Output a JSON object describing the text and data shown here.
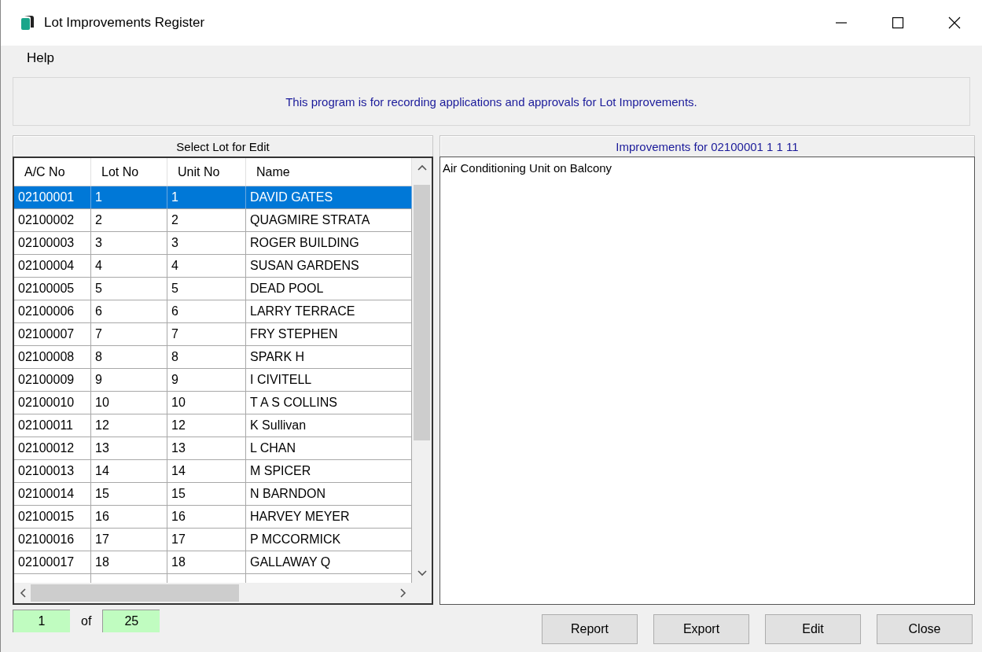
{
  "window": {
    "title": "Lot Improvements Register"
  },
  "menu": [
    "Help"
  ],
  "info": "This program is for recording applications and approvals for Lot Improvements.",
  "lot_panel": {
    "title": "Select Lot for Edit",
    "columns": [
      "A/C No",
      "Lot No",
      "Unit No",
      "Name"
    ],
    "rows": [
      {
        "cells": [
          "02100001",
          "1",
          "1",
          "DAVID GATES"
        ],
        "selected": true
      },
      {
        "cells": [
          "02100002",
          "2",
          "2",
          "QUAGMIRE STRATA"
        ],
        "selected": false
      },
      {
        "cells": [
          "02100003",
          "3",
          "3",
          "ROGER BUILDING"
        ],
        "selected": false
      },
      {
        "cells": [
          "02100004",
          "4",
          "4",
          "SUSAN GARDENS"
        ],
        "selected": false
      },
      {
        "cells": [
          "02100005",
          "5",
          "5",
          "DEAD POOL"
        ],
        "selected": false
      },
      {
        "cells": [
          "02100006",
          "6",
          "6",
          "LARRY TERRACE"
        ],
        "selected": false
      },
      {
        "cells": [
          "02100007",
          "7",
          "7",
          "FRY STEPHEN"
        ],
        "selected": false
      },
      {
        "cells": [
          "02100008",
          "8",
          "8",
          "SPARK H"
        ],
        "selected": false
      },
      {
        "cells": [
          "02100009",
          "9",
          "9",
          "I CIVITELL"
        ],
        "selected": false
      },
      {
        "cells": [
          "02100010",
          "10",
          "10",
          "T A S COLLINS"
        ],
        "selected": false
      },
      {
        "cells": [
          "02100011",
          "12",
          "12",
          "K Sullivan"
        ],
        "selected": false
      },
      {
        "cells": [
          "02100012",
          "13",
          "13",
          "L CHAN"
        ],
        "selected": false
      },
      {
        "cells": [
          "02100013",
          "14",
          "14",
          "M SPICER"
        ],
        "selected": false
      },
      {
        "cells": [
          "02100014",
          "15",
          "15",
          "N BARNDON"
        ],
        "selected": false
      },
      {
        "cells": [
          "02100015",
          "16",
          "16",
          "HARVEY MEYER"
        ],
        "selected": false
      },
      {
        "cells": [
          "02100016",
          "17",
          "17",
          "P MCCORMICK"
        ],
        "selected": false
      },
      {
        "cells": [
          "02100017",
          "18",
          "18",
          "GALLAWAY Q"
        ],
        "selected": false
      }
    ]
  },
  "improvements_panel": {
    "title": "Improvements for 02100001 1 1 11",
    "items": [
      "Air Conditioning Unit on Balcony"
    ]
  },
  "pager": {
    "current": "1",
    "of": "of",
    "total": "25"
  },
  "buttons": [
    "Report",
    "Export",
    "Edit",
    "Close"
  ]
}
